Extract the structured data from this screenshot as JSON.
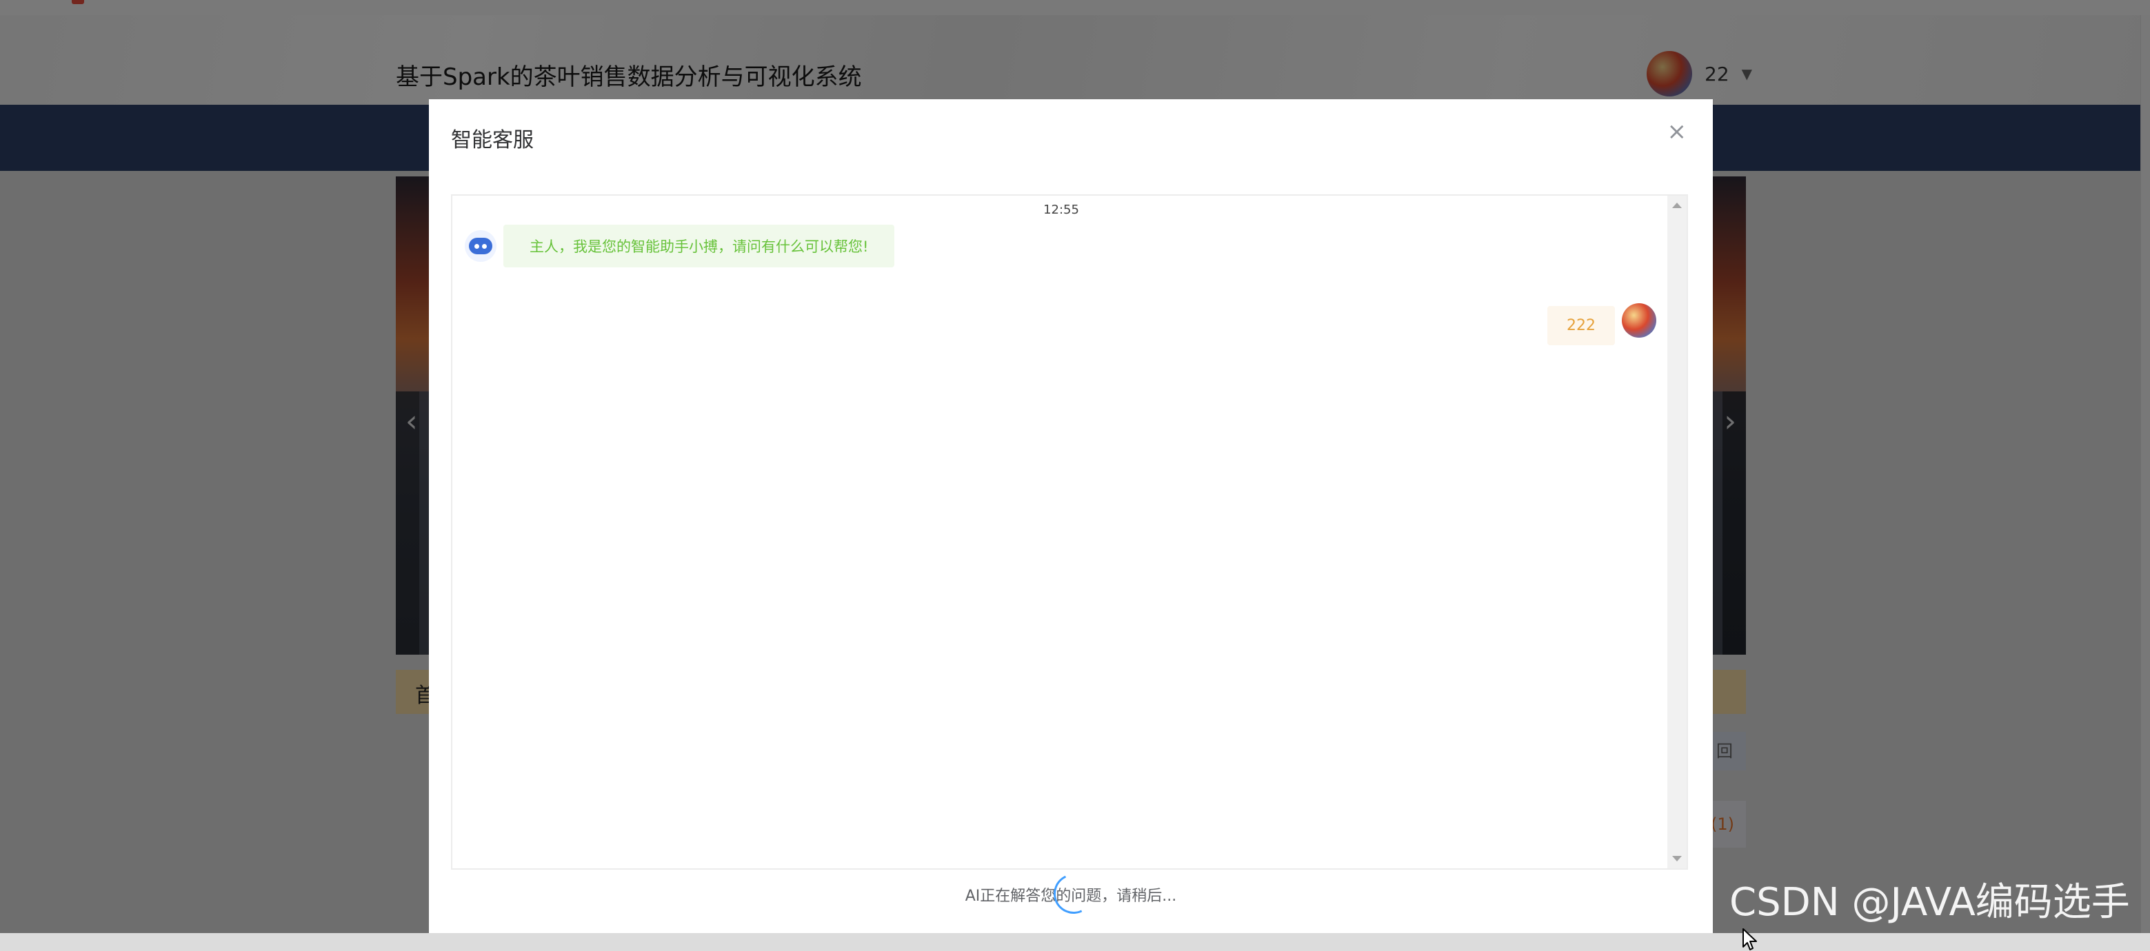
{
  "site": {
    "title": "基于Spark的茶叶销售数据分析与可视化系统",
    "user_name": "22",
    "caret": "▼",
    "banner_prev": "‹",
    "banner_next": "›",
    "tan_bar_text": "首",
    "side_button_text": "回",
    "side_count_text": "(1)"
  },
  "dialog": {
    "title": "智能客服",
    "close_icon": "×",
    "timestamp": "12:55",
    "bot_message": "主人，我是您的智能助手小搏，请问有什么可以帮您!",
    "user_message": "222",
    "status_text": "AI正在解答您的问题，请稍后..."
  },
  "watermark": "CSDN @JAVA编码选手",
  "colors": {
    "navbar": "#2c3e66",
    "bot_bubble_bg": "#f0f9eb",
    "bot_bubble_text": "#67c23a",
    "user_bubble_bg": "#fdf6ec",
    "user_bubble_text": "#e6a23c",
    "spinner": "#409eff"
  }
}
